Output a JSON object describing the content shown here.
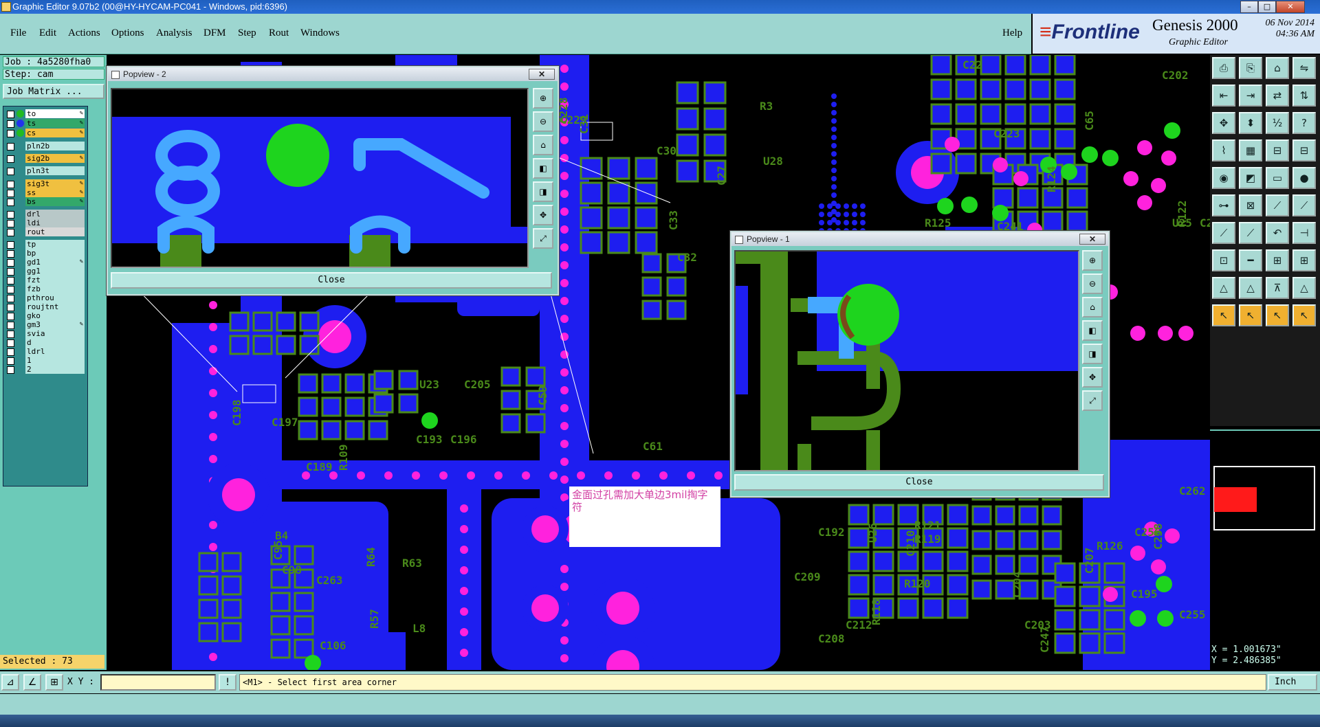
{
  "window": {
    "title": "Graphic Editor 9.07b2 (00@HY-HYCAM-PC041 - Windows, pid:6396)",
    "min_label": "–",
    "max_label": "□",
    "close_label": "✕"
  },
  "menu": [
    "File",
    "Edit",
    "Actions",
    "Options",
    "Analysis",
    "DFM",
    "Step",
    "Rout",
    "Windows"
  ],
  "help_label": "Help",
  "brand": {
    "logo": "Frontline",
    "product": "Genesis 2000",
    "subtitle": "Graphic Editor",
    "date": "06 Nov 2014",
    "time": "04:36 AM"
  },
  "job": {
    "job_label": "Job : 4a5280fha0",
    "step_label": "Step: cam",
    "matrix_button": "Job Matrix ..."
  },
  "layers": [
    {
      "name": "to",
      "bg": "#ffffff",
      "dot": "#22bb22",
      "edit": true
    },
    {
      "name": "ts",
      "bg": "#33a86a",
      "dot": "#2233ee",
      "edit": true
    },
    {
      "name": "cs",
      "bg": "#f0c040",
      "dot": "#22bb22",
      "edit": true
    },
    {
      "name": "pln2b",
      "bg": "#b6e6e0",
      "dot": "",
      "edit": false
    },
    {
      "name": "sig2b",
      "bg": "#f0c040",
      "dot": "",
      "edit": true
    },
    {
      "name": "pln3t",
      "bg": "#b6e6e0",
      "dot": "",
      "edit": false
    },
    {
      "name": "sig3t",
      "bg": "#f0c040",
      "dot": "",
      "edit": true
    },
    {
      "name": "ss",
      "bg": "#f0c040",
      "dot": "",
      "edit": true
    },
    {
      "name": "bs",
      "bg": "#33a86a",
      "dot": "",
      "edit": true
    },
    {
      "name": "drl",
      "bg": "#b8c8c8",
      "dot": "",
      "edit": false
    },
    {
      "name": "ldi",
      "bg": "#b8c8c8",
      "dot": "",
      "edit": false
    },
    {
      "name": "rout",
      "bg": "#d8d8d8",
      "dot": "",
      "edit": false
    },
    {
      "name": "tp",
      "bg": "#b6e6e0",
      "dot": "",
      "edit": false
    },
    {
      "name": "bp",
      "bg": "#b6e6e0",
      "dot": "",
      "edit": false
    },
    {
      "name": "gd1",
      "bg": "#b6e6e0",
      "dot": "",
      "edit": true
    },
    {
      "name": "gg1",
      "bg": "#b6e6e0",
      "dot": "",
      "edit": false
    },
    {
      "name": "fzt",
      "bg": "#b6e6e0",
      "dot": "",
      "edit": false
    },
    {
      "name": "fzb",
      "bg": "#b6e6e0",
      "dot": "",
      "edit": false
    },
    {
      "name": "pthrou",
      "bg": "#b6e6e0",
      "dot": "",
      "edit": false
    },
    {
      "name": "roujtnt",
      "bg": "#b6e6e0",
      "dot": "",
      "edit": false
    },
    {
      "name": "gko",
      "bg": "#b6e6e0",
      "dot": "",
      "edit": false
    },
    {
      "name": "gm3",
      "bg": "#b6e6e0",
      "dot": "",
      "edit": true
    },
    {
      "name": "svia",
      "bg": "#b6e6e0",
      "dot": "",
      "edit": false
    },
    {
      "name": "d",
      "bg": "#b6e6e0",
      "dot": "",
      "edit": false
    },
    {
      "name": "ldrl",
      "bg": "#b6e6e0",
      "dot": "",
      "edit": false
    },
    {
      "name": "1",
      "bg": "#b6e6e0",
      "dot": "",
      "edit": false
    },
    {
      "name": "2",
      "bg": "#b6e6e0",
      "dot": "",
      "edit": false
    }
  ],
  "selected_label": "Selected : 73",
  "popview2": {
    "title": "Popview - 2",
    "close": "Close",
    "x": "✕"
  },
  "popview1": {
    "title": "Popview - 1",
    "close": "Close",
    "x": "✕"
  },
  "note": "金面过孔需加大单边3mil掏字符",
  "silk_labels": [
    "C31",
    "C30",
    "U28",
    "C27",
    "R3",
    "C22",
    "R124",
    "R125",
    "C241",
    "C33",
    "C32",
    "C223",
    "C65",
    "U23",
    "C205",
    "C198",
    "C197",
    "C189",
    "R109",
    "C193",
    "C196",
    "C59",
    "C61",
    "B4",
    "C95",
    "C98",
    "C263",
    "R64",
    "R63",
    "C106",
    "R57",
    "L8",
    "C192",
    "U26",
    "R121",
    "R119",
    "C210",
    "C209",
    "R120",
    "R118",
    "C208",
    "C212",
    "C204",
    "C203",
    "R126",
    "C207",
    "C195",
    "C256",
    "C258",
    "C262",
    "C255",
    "C247",
    "C202",
    "U25",
    "R122",
    "C230",
    "C229",
    "C228"
  ],
  "coords": {
    "x": "X = 1.001673\"",
    "y": "Y = 2.486385\""
  },
  "status": {
    "xy_label": "X Y :",
    "prompt": "<M1> - Select first area corner",
    "unit": "Inch"
  }
}
